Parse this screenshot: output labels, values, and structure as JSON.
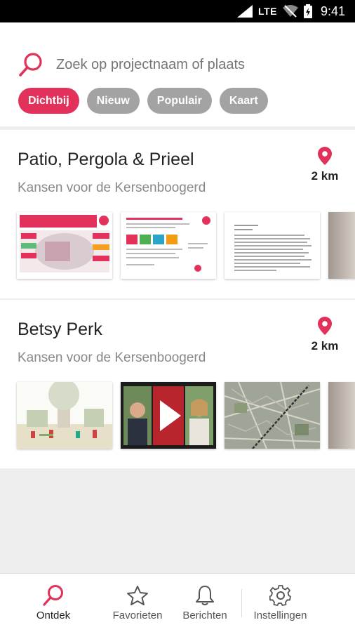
{
  "status_bar": {
    "network": "LTE",
    "time": "9:41"
  },
  "search": {
    "placeholder": "Zoek op projectnaam of plaats"
  },
  "filters": [
    {
      "label": "Dichtbij",
      "active": true
    },
    {
      "label": "Nieuw",
      "active": false
    },
    {
      "label": "Populair",
      "active": false
    },
    {
      "label": "Kaart",
      "active": false
    }
  ],
  "projects": [
    {
      "title": "Patio, Pergola & Prieel",
      "subtitle": "Kansen voor de Kersenboogerd",
      "distance": "2 km",
      "thumbnails": [
        "poster",
        "document",
        "letter",
        "photo"
      ]
    },
    {
      "title": "Betsy Perk",
      "subtitle": "Kansen voor de Kersenboogerd",
      "distance": "2 km",
      "thumbnails": [
        "illustration",
        "video",
        "map",
        "photo"
      ]
    }
  ],
  "nav": [
    {
      "label": "Ontdek",
      "icon": "search-icon",
      "active": true
    },
    {
      "label": "Favorieten",
      "icon": "star-icon",
      "active": false
    },
    {
      "label": "Berichten",
      "icon": "bell-icon",
      "active": false
    },
    {
      "label": "Instellingen",
      "icon": "gear-icon",
      "active": false
    }
  ],
  "colors": {
    "accent": "#e2315a",
    "chip_inactive": "#a3a3a3",
    "background": "#eeeeee"
  }
}
